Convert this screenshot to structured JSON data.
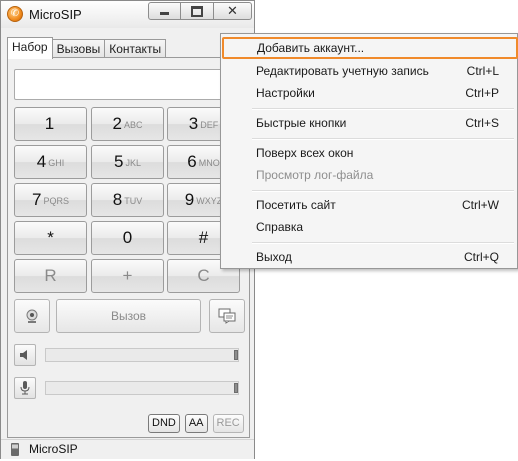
{
  "window": {
    "title": "MicroSIP",
    "controls": [
      "minimize",
      "maximize",
      "close"
    ]
  },
  "tabs": [
    {
      "label": "Набор",
      "active": true
    },
    {
      "label": "Вызовы",
      "active": false
    },
    {
      "label": "Контакты",
      "active": false
    }
  ],
  "dial": {
    "number_value": "",
    "keys": [
      {
        "digit": "1",
        "letters": ""
      },
      {
        "digit": "2",
        "letters": "ABC"
      },
      {
        "digit": "3",
        "letters": "DEF"
      },
      {
        "digit": "4",
        "letters": "GHI"
      },
      {
        "digit": "5",
        "letters": "JKL"
      },
      {
        "digit": "6",
        "letters": "MNO"
      },
      {
        "digit": "7",
        "letters": "PQRS"
      },
      {
        "digit": "8",
        "letters": "TUV"
      },
      {
        "digit": "9",
        "letters": "WXYZ"
      },
      {
        "digit": "*",
        "letters": ""
      },
      {
        "digit": "0",
        "letters": ""
      },
      {
        "digit": "#",
        "letters": ""
      },
      {
        "digit": "R",
        "letters": ""
      },
      {
        "digit": "+",
        "letters": ""
      },
      {
        "digit": "C",
        "letters": ""
      }
    ],
    "call_label": "Вызов",
    "speaker_volume": 1.0,
    "mic_volume": 1.0,
    "options": [
      {
        "label": "DND",
        "enabled": true
      },
      {
        "label": "AA",
        "enabled": true
      },
      {
        "label": "REC",
        "enabled": false
      }
    ]
  },
  "status": {
    "text": "MicroSIP"
  },
  "menu": {
    "items": [
      {
        "label": "Добавить аккаунт...",
        "shortcut": "",
        "highlighted": true,
        "enabled": true
      },
      {
        "label": "Редактировать учетную запись",
        "shortcut": "Ctrl+L",
        "enabled": true
      },
      {
        "label": "Настройки",
        "shortcut": "Ctrl+P",
        "enabled": true
      },
      {
        "label": "Быстрые кнопки",
        "shortcut": "Ctrl+S",
        "enabled": true
      },
      {
        "label": "Поверх всех окон",
        "shortcut": "",
        "enabled": true
      },
      {
        "label": "Просмотр лог-файла",
        "shortcut": "",
        "enabled": false
      },
      {
        "label": "Посетить сайт",
        "shortcut": "Ctrl+W",
        "enabled": true
      },
      {
        "label": "Справка",
        "shortcut": "",
        "enabled": true
      },
      {
        "label": "Выход",
        "shortcut": "Ctrl+Q",
        "enabled": true
      }
    ]
  },
  "colors": {
    "highlight_border": "#f08a2b",
    "disabled_text": "#8e8e8e",
    "window_bg": "#f0f0f0"
  }
}
